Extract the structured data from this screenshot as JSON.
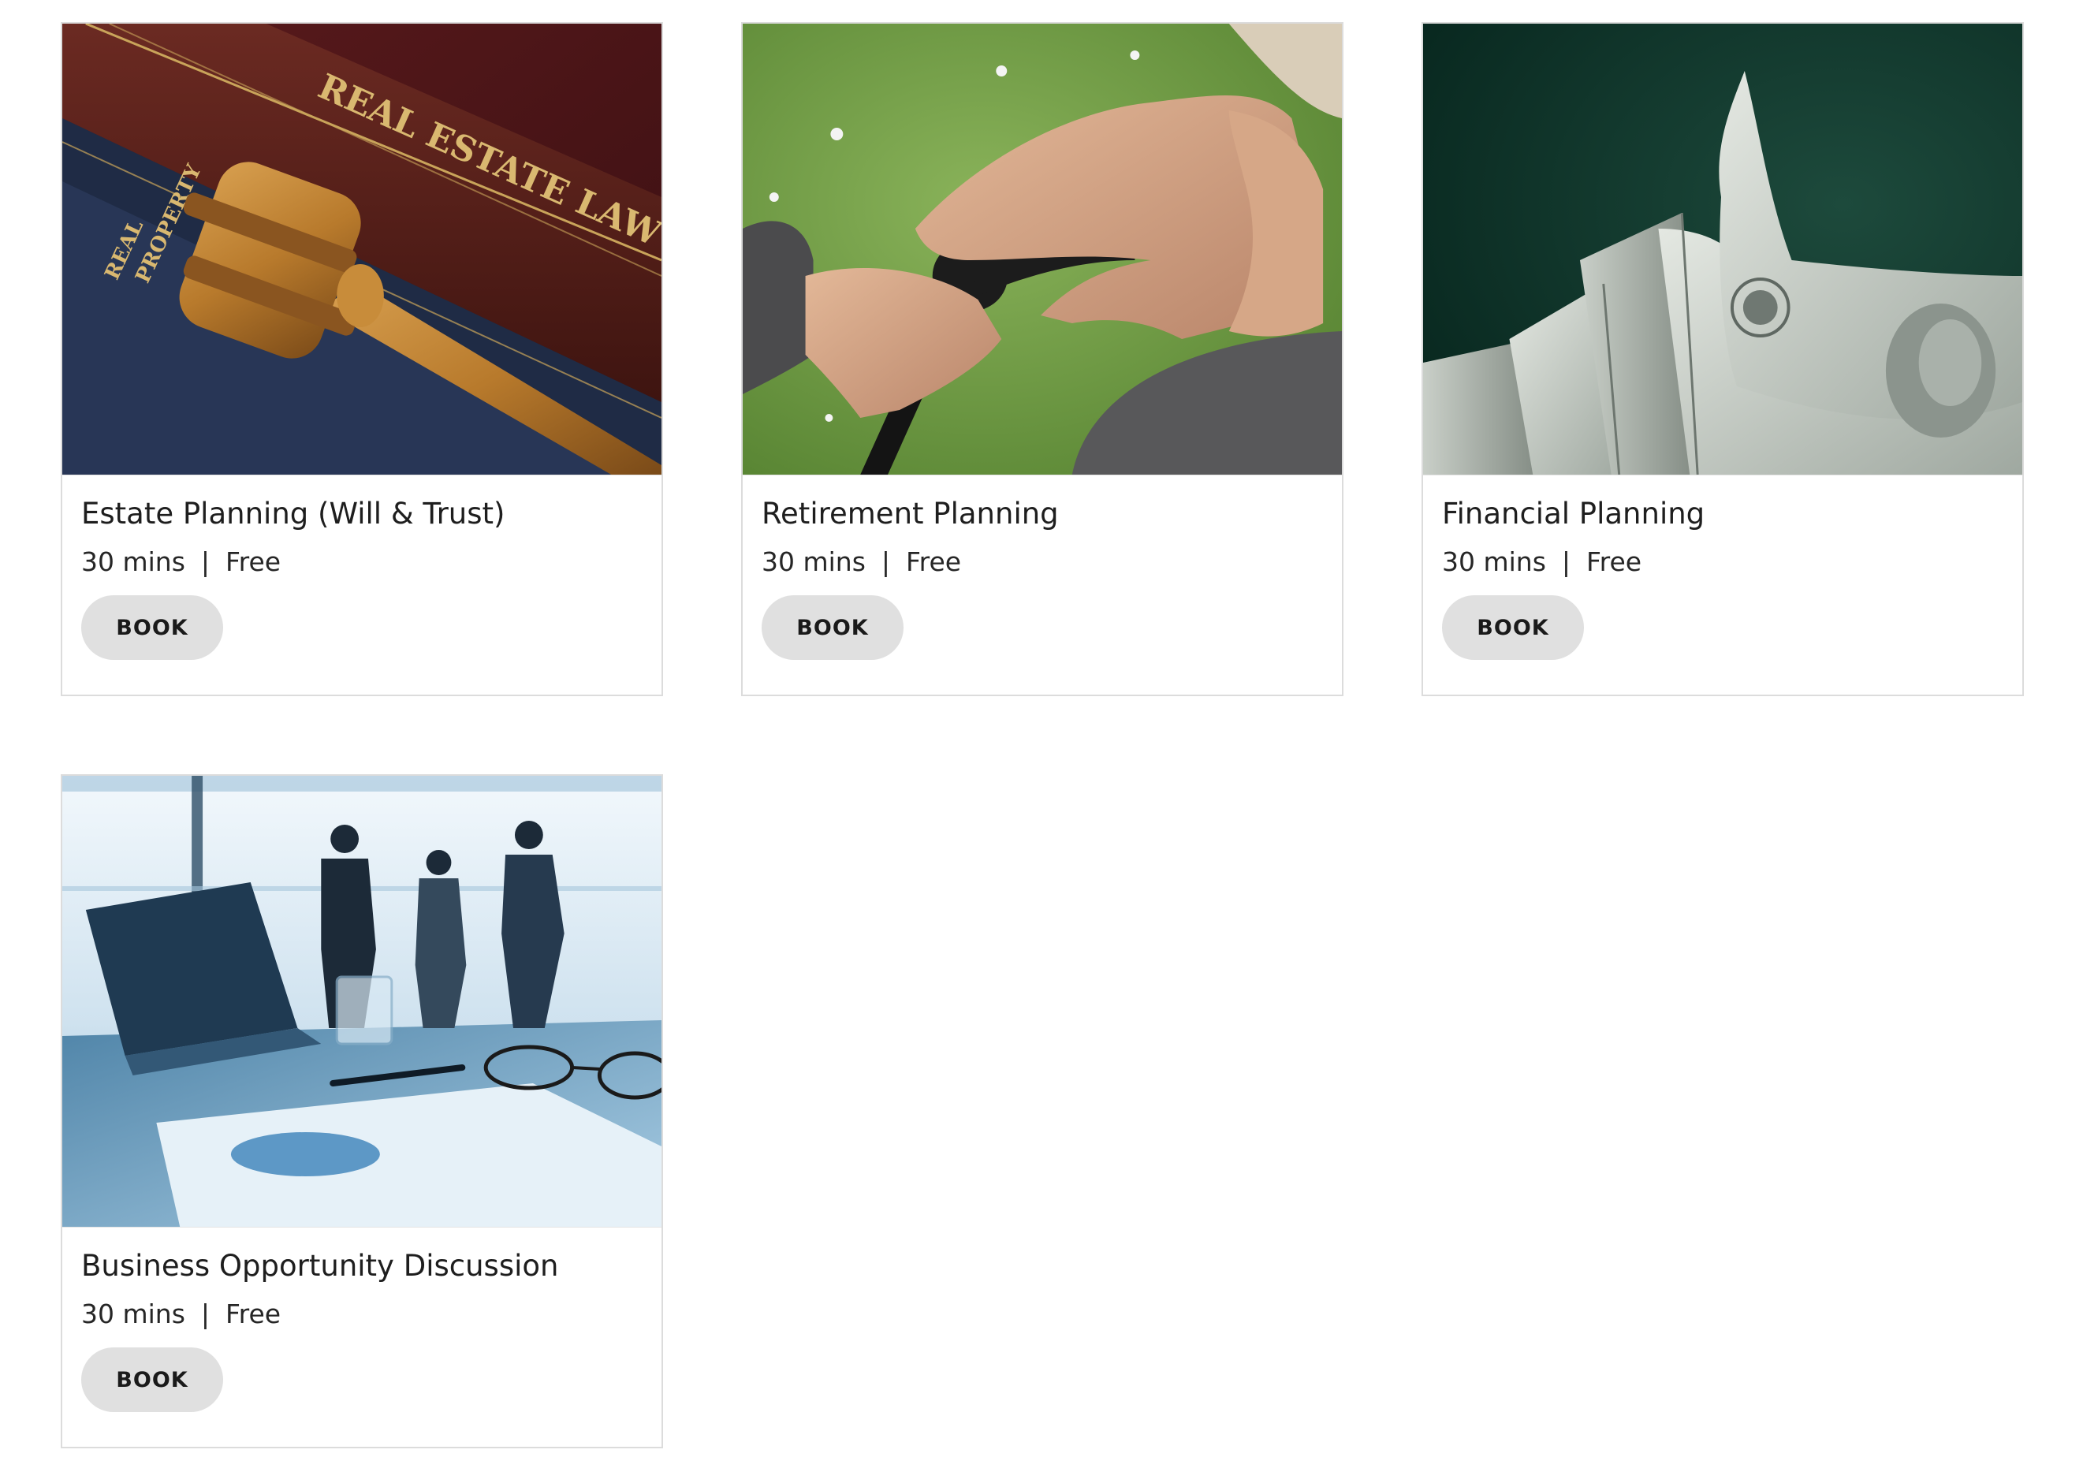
{
  "services": [
    {
      "name": "Estate Planning (Will & Trust)",
      "duration": "30 mins",
      "separator": "|",
      "price": "Free",
      "book_label": "BOOK",
      "image": {
        "name": "estate-planning-image",
        "spine_title": "REAL ESTATE LAW",
        "spine_title_2": "REAL",
        "spine_title_3": "PROPERTY"
      }
    },
    {
      "name": "Retirement Planning",
      "duration": "30 mins",
      "separator": "|",
      "price": "Free",
      "book_label": "BOOK",
      "image": {
        "name": "retirement-planning-image"
      }
    },
    {
      "name": "Financial Planning",
      "duration": "30 mins",
      "separator": "|",
      "price": "Free",
      "book_label": "BOOK",
      "image": {
        "name": "financial-planning-image"
      }
    },
    {
      "name": "Business Opportunity Discussion",
      "duration": "30 mins",
      "separator": "|",
      "price": "Free",
      "book_label": "BOOK",
      "image": {
        "name": "business-opportunity-image"
      }
    }
  ],
  "colors": {
    "card_border": "#dcdcdc",
    "button_bg": "#e0e0e0",
    "text": "#1e1e1e"
  }
}
